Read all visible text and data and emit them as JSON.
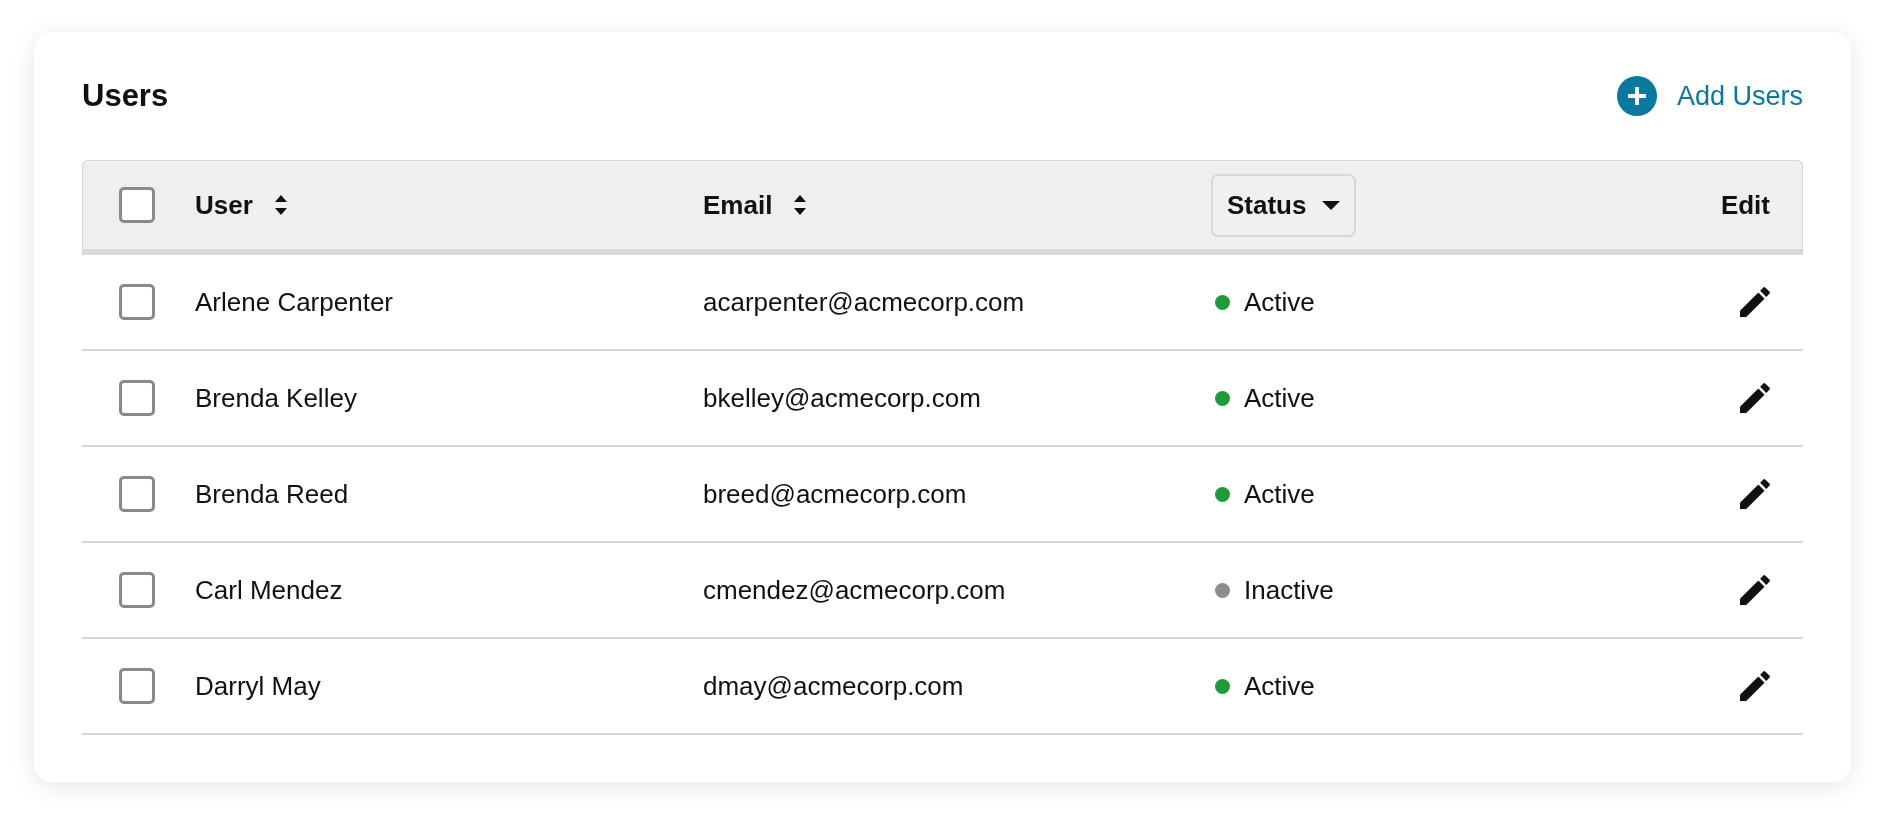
{
  "title": "Users",
  "add_button": {
    "label": "Add Users"
  },
  "table": {
    "select_all": {
      "checked": false
    },
    "columns": [
      {
        "label": "User",
        "kind": "sortable"
      },
      {
        "label": "Email",
        "kind": "sortable"
      },
      {
        "label": "Status",
        "kind": "filter"
      },
      {
        "label": "Edit",
        "kind": "plain"
      }
    ],
    "rows": [
      {
        "checked": false,
        "user": "Arlene Carpenter",
        "email": "acarpenter@acmecorp.com",
        "status": {
          "label": "Active",
          "color": "#1f9a3a"
        }
      },
      {
        "checked": false,
        "user": "Brenda Kelley",
        "email": "bkelley@acmecorp.com",
        "status": {
          "label": "Active",
          "color": "#1f9a3a"
        }
      },
      {
        "checked": false,
        "user": "Brenda Reed",
        "email": "breed@acmecorp.com",
        "status": {
          "label": "Active",
          "color": "#1f9a3a"
        }
      },
      {
        "checked": false,
        "user": "Carl Mendez",
        "email": "cmendez@acmecorp.com",
        "status": {
          "label": "Inactive",
          "color": "#8c8c8c"
        }
      },
      {
        "checked": false,
        "user": "Darryl May",
        "email": "dmay@acmecorp.com",
        "status": {
          "label": "Active",
          "color": "#1f9a3a"
        }
      }
    ]
  }
}
